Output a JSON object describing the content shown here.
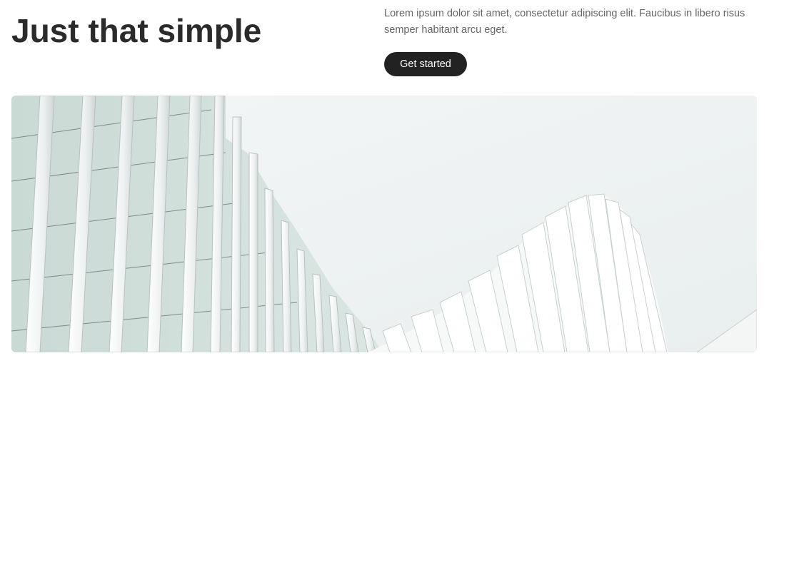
{
  "hero": {
    "title": "Just that simple",
    "description": "Lorem ipsum dolor sit amet, consectetur adipiscing elit. Faucibus in libero risus semper habitant arcu eget.",
    "cta_label": "Get started"
  },
  "colors": {
    "cta_background": "#222222",
    "cta_text": "#ffffff",
    "title_text": "#2b2b2b",
    "description_text": "#666666"
  }
}
